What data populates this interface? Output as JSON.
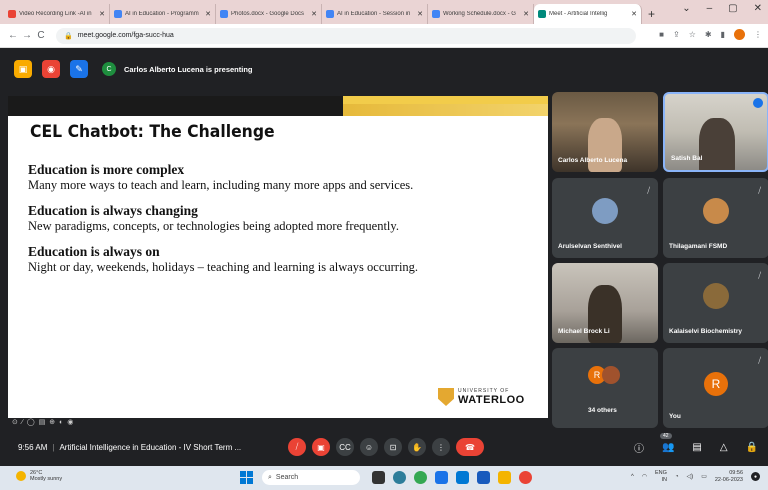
{
  "browser": {
    "tabs": [
      {
        "label": "Video Recording Link -AI in",
        "icon_color": "#ea4335",
        "active": false
      },
      {
        "label": "AI in Education - Programm",
        "icon_color": "#4285f4",
        "active": false
      },
      {
        "label": "Photos.docx - Google Docs",
        "icon_color": "#4285f4",
        "active": false
      },
      {
        "label": "AI in Education - Session in",
        "icon_color": "#4285f4",
        "active": false
      },
      {
        "label": "Working Schedule.docx - G",
        "icon_color": "#4285f4",
        "active": false
      },
      {
        "label": "Meet - Artificial Intellig",
        "icon_color": "#00897b",
        "active": true
      }
    ],
    "new_tab": "+",
    "address": "meet.google.com/fga-succ-hua",
    "window_controls": [
      "⌄",
      "–",
      "▢",
      "✕"
    ]
  },
  "presenting": {
    "label": "Carlos Alberto Lucena is presenting",
    "avatar_letter": "C"
  },
  "slide": {
    "title": "CEL Chatbot: The Challenge",
    "bullets": [
      {
        "heading": "Education is more complex",
        "body": "Many more ways to teach and learn, including many more apps and services."
      },
      {
        "heading": "Education is always changing",
        "body": "New paradigms, concepts, or technologies being adopted more frequently."
      },
      {
        "heading": "Education is always on",
        "body": "Night or day, weekends, holidays – teaching and learning is always occurring."
      }
    ],
    "logo_small": "UNIVERSITY OF",
    "logo_big": "WATERLOO",
    "accent": "#f2cc4a"
  },
  "participants": [
    {
      "name": "Carlos Alberto Lucena",
      "type": "video"
    },
    {
      "name": "Satish Bal",
      "type": "video"
    },
    {
      "name": "Arulselvan Senthivel",
      "type": "photo"
    },
    {
      "name": "Thilagamani FSMD",
      "type": "photo"
    },
    {
      "name": "Michael Brock Li",
      "type": "video"
    },
    {
      "name": "Kalaiselvi Biochemistry",
      "type": "photo"
    },
    {
      "name": "34 others",
      "type": "others",
      "letter": "R"
    },
    {
      "name": "You",
      "type": "self",
      "letter": "R"
    }
  ],
  "controls": {
    "time": "9:56 AM",
    "meeting_title": "Artificial Intelligence in Education - IV Short Term ...",
    "participant_count": "42"
  },
  "taskbar": {
    "temp": "26°C",
    "weather": "Mostly sunny",
    "search": "Search",
    "lang": "ENG",
    "region": "IN",
    "time": "09:56",
    "date": "22-06-2023"
  }
}
